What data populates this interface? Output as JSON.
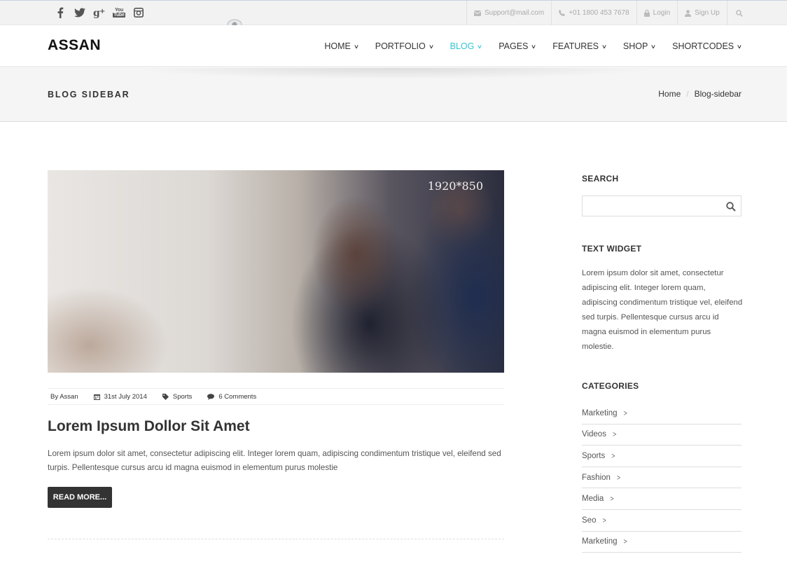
{
  "topbar": {
    "social": [
      "facebook-icon",
      "twitter-icon",
      "google-plus-icon",
      "youtube-icon",
      "instagram-icon"
    ],
    "youtube_top": "You",
    "youtube_bottom": "Tube",
    "email": "Support@mail.com",
    "phone": "+01 1800 453 7678",
    "login": "Login",
    "signup": "Sign Up"
  },
  "header": {
    "logo": "ASSAN",
    "nav": [
      {
        "label": "HOME"
      },
      {
        "label": "PORTFOLIO"
      },
      {
        "label": "BLOG"
      },
      {
        "label": "PAGES"
      },
      {
        "label": "FEATURES"
      },
      {
        "label": "SHOP"
      },
      {
        "label": "SHORTCODES"
      }
    ],
    "active_color": "#32c5d2"
  },
  "page_header": {
    "title": "BLOG SIDEBAR",
    "breadcrumb": [
      "Home",
      "Blog-sidebar"
    ]
  },
  "post": {
    "image_label": "1920*850",
    "author": "By Assan",
    "date": "31st July 2014",
    "tag": "Sports",
    "comments": "6 Comments",
    "title": "Lorem Ipsum Dollor Sit Amet",
    "excerpt": "Lorem ipsum dolor sit amet, consectetur adipiscing elit. Integer lorem quam, adipiscing condimentum tristique vel, eleifend sed turpis. Pellentesque cursus arcu id magna euismod in elementum purus molestie",
    "read_more": "READ MORE..."
  },
  "sidebar": {
    "search_heading": "SEARCH",
    "search_placeholder": "",
    "text_widget_heading": "TEXT WIDGET",
    "text_widget_body": "Lorem ipsum dolor sit amet, consectetur adipiscing elit. Integer lorem quam, adipiscing condimentum tristique vel, eleifend sed turpis. Pellentesque cursus arcu id magna euismod in elementum purus molestie.",
    "categories_heading": "CATEGORIES",
    "categories": [
      "Marketing",
      "Videos",
      "Sports",
      "Fashion",
      "Media",
      "Seo",
      "Marketing"
    ]
  }
}
